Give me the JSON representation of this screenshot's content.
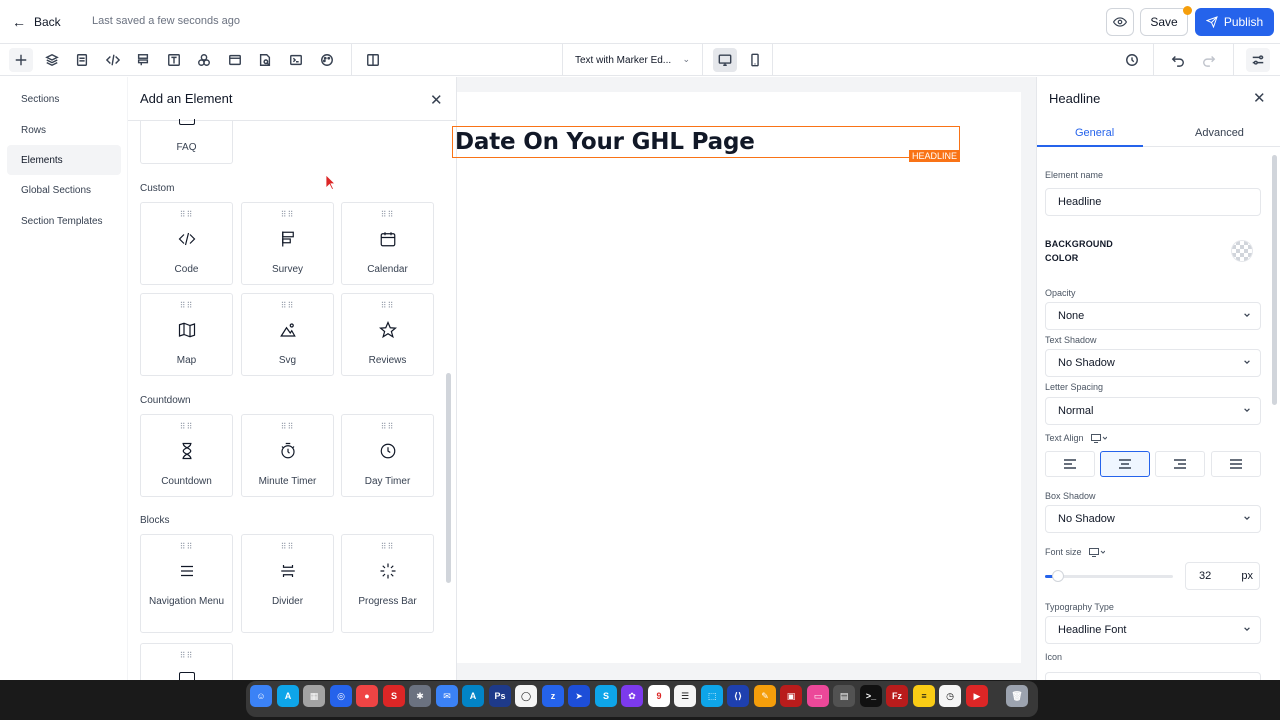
{
  "topbar": {
    "back_label": "Back",
    "saved_status": "Last saved a few seconds ago",
    "save_label": "Save",
    "publish_label": "Publish"
  },
  "toolbar": {
    "tools": [
      "add-icon",
      "layers-icon",
      "page-icon",
      "code-icon",
      "form-icon",
      "text-icon",
      "shapes-icon",
      "section-icon",
      "search-doc-icon",
      "terminal-icon",
      "palette-icon",
      "columns-icon"
    ],
    "page_name": "Text with Marker Ed...",
    "right_tools": [
      "history-icon",
      "undo-icon",
      "redo-icon",
      "settings-sliders-icon"
    ]
  },
  "leftnav": {
    "items": [
      {
        "label": "Sections"
      },
      {
        "label": "Rows"
      },
      {
        "label": "Elements"
      },
      {
        "label": "Global Sections"
      },
      {
        "label": "Section Templates"
      }
    ]
  },
  "add_panel": {
    "title": "Add an Element",
    "faq_label": "FAQ",
    "groups": [
      {
        "label": "Custom",
        "tiles": [
          {
            "label": "Code",
            "icon": "code-icon"
          },
          {
            "label": "Survey",
            "icon": "survey-icon"
          },
          {
            "label": "Calendar",
            "icon": "calendar-icon"
          },
          {
            "label": "Map",
            "icon": "map-icon"
          },
          {
            "label": "Svg",
            "icon": "image-icon"
          },
          {
            "label": "Reviews",
            "icon": "star-icon"
          }
        ]
      },
      {
        "label": "Countdown",
        "tiles": [
          {
            "label": "Countdown",
            "icon": "hourglass-icon"
          },
          {
            "label": "Minute Timer",
            "icon": "stopwatch-icon"
          },
          {
            "label": "Day Timer",
            "icon": "clock-icon"
          }
        ]
      },
      {
        "label": "Blocks",
        "tiles": [
          {
            "label": "Navigation Menu",
            "icon": "menu-icon"
          },
          {
            "label": "Divider",
            "icon": "divider-icon"
          },
          {
            "label": "Progress Bar",
            "icon": "spinner-icon"
          }
        ]
      }
    ]
  },
  "canvas": {
    "headline_text": "Date On Your GHL Page",
    "headline_tag": "HEADLINE"
  },
  "settings": {
    "title": "Headline",
    "tabs": [
      "General",
      "Advanced"
    ],
    "element_name_label": "Element name",
    "element_name_value": "Headline",
    "background_color_line1": "BACKGROUND",
    "background_color_line2": "COLOR",
    "opacity_label": "Opacity",
    "opacity_value": "None",
    "text_shadow_label": "Text Shadow",
    "text_shadow_value": "No Shadow",
    "letter_spacing_label": "Letter Spacing",
    "letter_spacing_value": "Normal",
    "text_align_label": "Text Align",
    "box_shadow_label": "Box Shadow",
    "box_shadow_value": "No Shadow",
    "font_size_label": "Font size",
    "font_size_value": "32",
    "font_size_unit": "px",
    "typography_label": "Typography Type",
    "typography_value": "Headline Font",
    "icon_label": "Icon"
  },
  "colors": {
    "accent": "#2563eb",
    "selection": "#f97316"
  }
}
